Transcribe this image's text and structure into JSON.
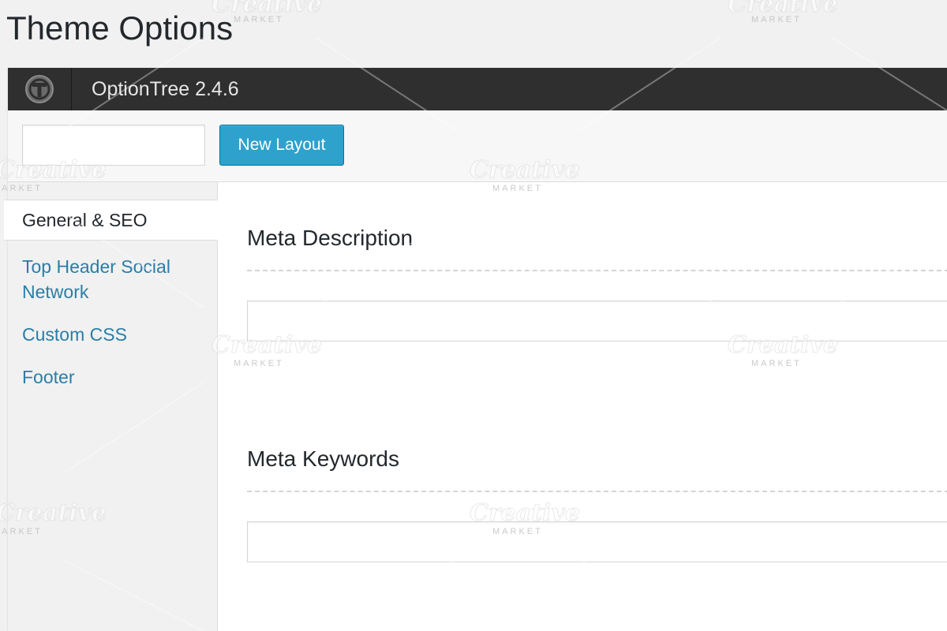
{
  "page": {
    "title": "Theme Options"
  },
  "header": {
    "logo_icon": "optiontree-logo-icon",
    "version_label": "OptionTree 2.4.6"
  },
  "toolbar": {
    "layout_input_value": "",
    "layout_input_placeholder": "",
    "new_layout_label": "New Layout"
  },
  "sidebar": {
    "items": [
      {
        "label": "General & SEO",
        "active": true
      },
      {
        "label": "Top Header Social Network",
        "active": false
      },
      {
        "label": "Custom CSS",
        "active": false
      },
      {
        "label": "Footer",
        "active": false
      }
    ]
  },
  "content": {
    "sections": [
      {
        "title": "Meta Description",
        "value": ""
      },
      {
        "title": "Meta Keywords",
        "value": ""
      }
    ]
  },
  "watermark": {
    "brand": "Creative",
    "sub": "MARKET"
  },
  "colors": {
    "header_bg": "#2f2f2f",
    "button_bg": "#2ea2cc",
    "link_color": "#2a7ea6",
    "page_bg": "#f1f1f1"
  }
}
